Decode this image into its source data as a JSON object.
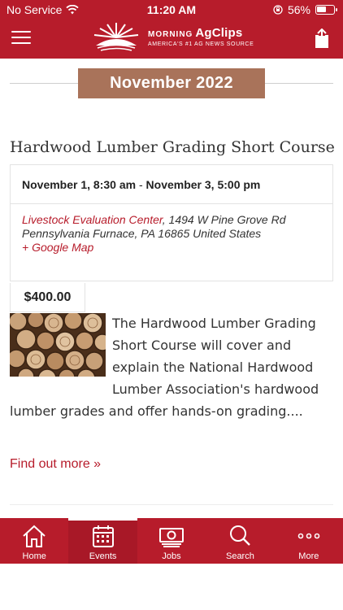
{
  "status": {
    "carrier": "No Service",
    "time": "11:20 AM",
    "battery": "56%"
  },
  "header": {
    "logo_small": "MORNING",
    "logo_brand": "AgClips",
    "logo_tag": "AMERICA'S #1 AG NEWS SOURCE"
  },
  "month": "November 2022",
  "event": {
    "title": "Hardwood Lumber Grading Short Course",
    "start": "November 1, 8:30 am",
    "separator": " - ",
    "end": "November 3, 5:00 pm",
    "venue_name": "Livestock Evaluation Center",
    "venue_address_1": ", 1494 W Pine Grove Rd",
    "venue_address_2": "Pennsylvania Furnace, PA 16865 United States",
    "map_link": "+ Google Map",
    "price": "$400.00",
    "excerpt": "The Hardwood Lumber Grading Short Course will cover and explain the National Hardwood Lumber Association's hardwood lumber grades and offer hands-on grading....",
    "find_out_more": "Find out more »"
  },
  "tabs": [
    {
      "label": "Home",
      "icon": "home-icon"
    },
    {
      "label": "Events",
      "icon": "calendar-icon",
      "active": true
    },
    {
      "label": "Jobs",
      "icon": "money-icon"
    },
    {
      "label": "Search",
      "icon": "search-icon"
    },
    {
      "label": "More",
      "icon": "more-icon"
    }
  ],
  "colors": {
    "brand_red": "#b71c2b",
    "month_badge": "#a9735a"
  }
}
